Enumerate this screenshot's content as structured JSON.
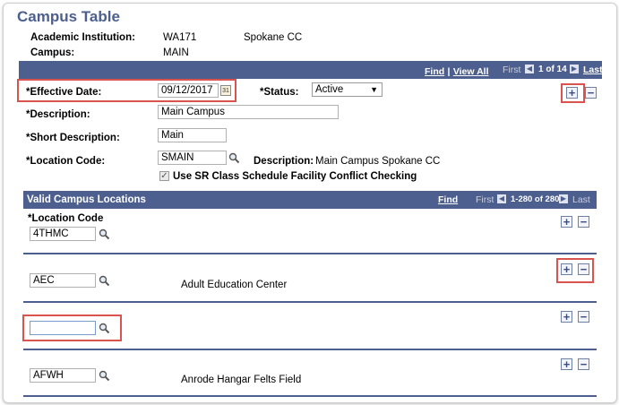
{
  "page": {
    "title": "Campus Table",
    "academic_institution_label": "Academic Institution:",
    "academic_institution_code": "WA171",
    "academic_institution_name": "Spokane CC",
    "campus_label": "Campus:",
    "campus_value": "MAIN"
  },
  "nav": {
    "find": "Find",
    "sep": "|",
    "view_all": "View All",
    "first": "First",
    "count": "1 of 14",
    "last": "Last"
  },
  "form": {
    "effective_date_label": "*Effective Date:",
    "effective_date_value": "09/12/2017",
    "status_label": "*Status:",
    "status_value": "Active",
    "description_label": "*Description:",
    "description_value": "Main Campus",
    "short_description_label": "*Short Description:",
    "short_description_value": "Main",
    "location_code_label": "*Location Code:",
    "location_code_value": "SMAIN",
    "description_inline_label": "Description:",
    "description_inline_value": "Main Campus Spokane CC",
    "conflict_check_label": "Use SR Class Schedule Facility Conflict Checking",
    "conflict_check_checked": true
  },
  "locations": {
    "header": "Valid Campus Locations",
    "find": "Find",
    "first": "First",
    "count": "1-280 of 280",
    "last": "Last",
    "column_label": "*Location Code",
    "rows": [
      {
        "code": "4THMC",
        "description": ""
      },
      {
        "code": "AEC",
        "description": "Adult Education Center"
      },
      {
        "code": "",
        "description": ""
      },
      {
        "code": "AFWH",
        "description": "Anrode Hangar Felts Field"
      }
    ]
  },
  "icons": {
    "add": "+",
    "remove": "−",
    "calendar": "31",
    "first_arrow": "◀",
    "last_arrow": "▶",
    "dropdown": "▼",
    "check": "✓"
  },
  "colors": {
    "title": "#4c5f8e",
    "bar": "#4d5f8e",
    "highlight": "#d9534f"
  }
}
